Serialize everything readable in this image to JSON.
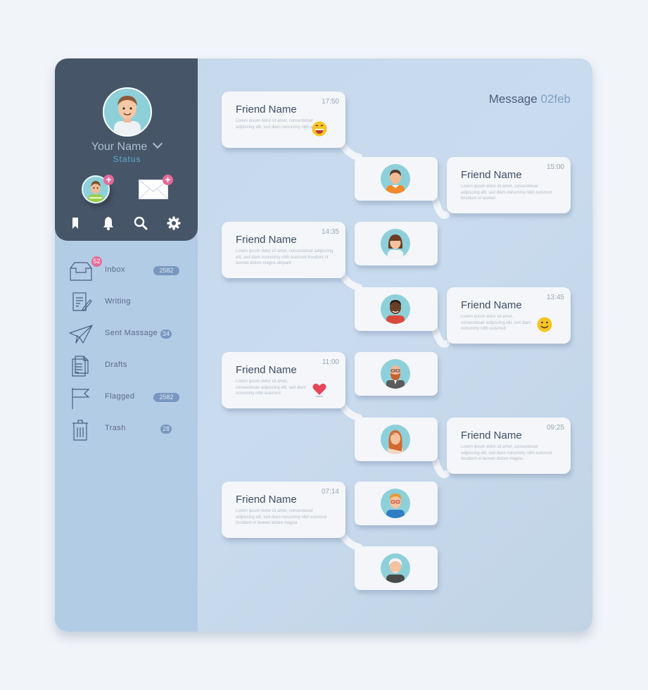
{
  "profile": {
    "name": "Your Name",
    "status": "Status"
  },
  "toolbar": {
    "icons": [
      "bookmark-icon",
      "bell-icon",
      "search-icon",
      "gear-icon"
    ]
  },
  "sidebar": {
    "items": [
      {
        "label": "Inbox",
        "icon": "inbox-icon",
        "count": "2582",
        "unread": "52"
      },
      {
        "label": "Writing",
        "icon": "writing-icon",
        "count": ""
      },
      {
        "label": "Sent Massage",
        "icon": "paper-plane-icon",
        "count": "34"
      },
      {
        "label": "Drafts",
        "icon": "drafts-icon",
        "count": ""
      },
      {
        "label": "Flagged",
        "icon": "flag-icon",
        "count": "2582"
      },
      {
        "label": "Trash",
        "icon": "trash-icon",
        "count": "28"
      }
    ]
  },
  "header": {
    "title": "Message",
    "date": "02feb"
  },
  "messages": [
    {
      "name": "Friend Name",
      "time": "17:50",
      "text": "Lorem ipsum dolor sit amet, consectetuer adipiscing elit, sed diam nonummy nibh euismod",
      "emoji": "laughing-emoji",
      "side": "left"
    },
    {
      "name": "Friend Name",
      "time": "15:00",
      "text": "Lorem ipsum dolor sit amet, consectetuer adipiscing elit, sed diam nonummy nibh euismod tincidunt ut laoreet",
      "emoji": "",
      "side": "right"
    },
    {
      "name": "Friend Name",
      "time": "14:35",
      "text": "Lorem ipsum dolor sit amet, consectetuer adipiscing elit, sed diam nonummy nibh euismod tincidunt ut laoreet dolore magna aliquam",
      "emoji": "",
      "side": "left"
    },
    {
      "name": "Friend Name",
      "time": "13:45",
      "text": "Lorem ipsum dolor sit amet, consectetuer adipiscing elit, sed diam nonummy nibh euismod",
      "emoji": "smiley-emoji",
      "side": "right"
    },
    {
      "name": "Friend Name",
      "time": "11:00",
      "text": "Lorem ipsum dolor sit amet, consectetuer adipiscing elit, sed diam nonummy nibh euismod",
      "emoji": "heart-emoji",
      "side": "left"
    },
    {
      "name": "Friend Name",
      "time": "09:25",
      "text": "Lorem ipsum dolor sit amet, consectetuer adipiscing elit, sed diam nonummy nibh euismod tincidunt ut laoreet dolore magna",
      "emoji": "",
      "side": "right"
    },
    {
      "name": "Friend Name",
      "time": "07:14",
      "text": "Lorem ipsum dolor sit amet, consectetuer adipiscing elit, sed diam nonummy nibh euismod tincidunt ut laoreet dolore magna",
      "emoji": "",
      "side": "left"
    }
  ],
  "contacts": [
    {
      "avatar": "boy-orange-shirt-avatar"
    },
    {
      "avatar": "girl-brown-hair-avatar"
    },
    {
      "avatar": "dark-skin-boy-avatar"
    },
    {
      "avatar": "bearded-man-glasses-avatar"
    },
    {
      "avatar": "red-hair-woman-avatar"
    },
    {
      "avatar": "man-glasses-blue-shirt-avatar"
    },
    {
      "avatar": "elderly-man-avatar"
    }
  ],
  "colors": {
    "profile_bg": "#475569",
    "sidebar_bg": "#b3cce6",
    "accent_pink": "#e46a9a",
    "pill_blue": "#7797c0",
    "status_blue": "#5aaed0"
  }
}
